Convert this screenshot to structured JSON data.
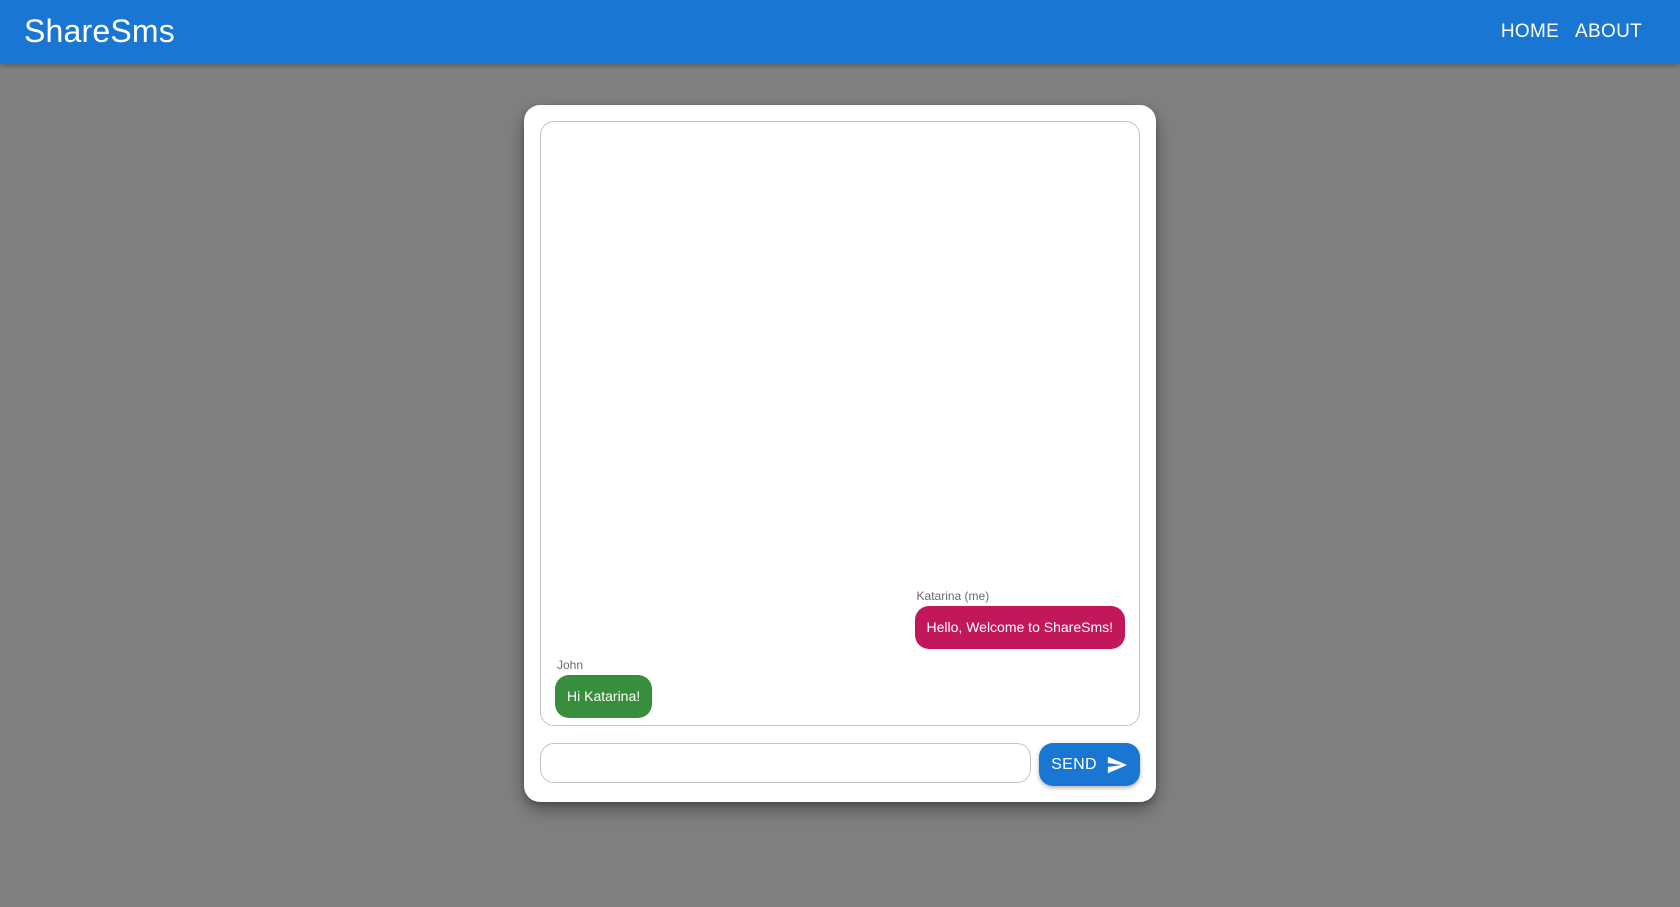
{
  "app": {
    "title": "ShareSms"
  },
  "nav": {
    "items": [
      {
        "label": "HOME"
      },
      {
        "label": "ABOUT"
      }
    ]
  },
  "chat": {
    "messages": [
      {
        "sender": "Katarina (me)",
        "text": "Hello, Welcome to ShareSms!",
        "mine": true,
        "color": "#c2185b"
      },
      {
        "sender": "John",
        "text": "Hi Katarina!",
        "mine": false,
        "color": "#388e3c"
      }
    ],
    "input": {
      "value": "",
      "placeholder": ""
    },
    "send_label": "SEND",
    "send_icon": "send-icon"
  },
  "colors": {
    "appbar": "#1976d2",
    "background": "#808080",
    "accent": "#1976d2"
  }
}
